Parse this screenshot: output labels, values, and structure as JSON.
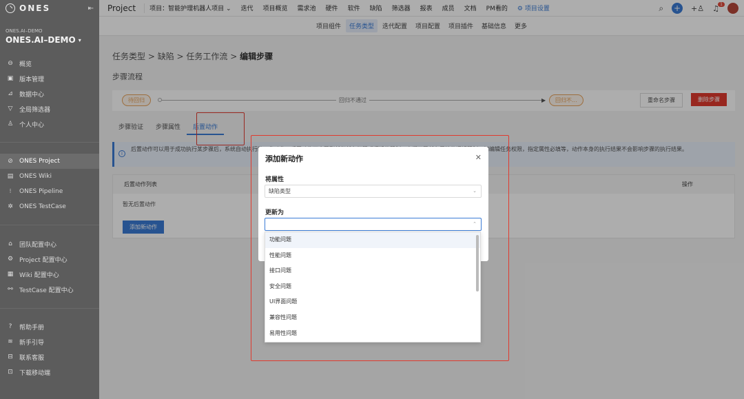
{
  "sidebar": {
    "logo": "ONES",
    "org_small": "ONES.AI–DEMO",
    "org_name": "ONES.AI–DEMO",
    "group1": [
      {
        "label": "概览",
        "icon": "overview-icon"
      },
      {
        "label": "版本管理",
        "icon": "version-icon"
      },
      {
        "label": "数据中心",
        "icon": "chart-icon"
      },
      {
        "label": "全局筛选器",
        "icon": "filter-icon"
      },
      {
        "label": "个人中心",
        "icon": "user-icon"
      }
    ],
    "group2": [
      {
        "label": "ONES Project",
        "icon": "project-icon",
        "active": true
      },
      {
        "label": "ONES Wiki",
        "icon": "wiki-icon"
      },
      {
        "label": "ONES Pipeline",
        "icon": "pipeline-icon"
      },
      {
        "label": "ONES TestCase",
        "icon": "testcase-icon"
      }
    ],
    "group3": [
      {
        "label": "团队配置中心",
        "icon": "team-config-icon"
      },
      {
        "label": "Project 配置中心",
        "icon": "gear-icon"
      },
      {
        "label": "Wiki 配置中心",
        "icon": "wiki-config-icon"
      },
      {
        "label": "TestCase 配置中心",
        "icon": "testcase-config-icon"
      }
    ],
    "group4": [
      {
        "label": "帮助手册",
        "icon": "help-icon"
      },
      {
        "label": "新手引导",
        "icon": "guide-icon"
      },
      {
        "label": "联系客服",
        "icon": "support-icon"
      },
      {
        "label": "下载移动端",
        "icon": "download-icon"
      }
    ]
  },
  "topbar": {
    "product": "Project",
    "project_select": "项目：智能护理机器人项目",
    "items": [
      "迭代",
      "项目概览",
      "需求池",
      "硬件",
      "软件",
      "缺陷",
      "筛选器",
      "报表",
      "成员",
      "文档",
      "PM看的"
    ],
    "settings": "项目设置",
    "badge": "1"
  },
  "subtabs": [
    {
      "label": "项目组件"
    },
    {
      "label": "任务类型",
      "active": true
    },
    {
      "label": "迭代配置"
    },
    {
      "label": "项目配置"
    },
    {
      "label": "项目插件"
    },
    {
      "label": "基础信息"
    },
    {
      "label": "更多"
    }
  ],
  "breadcrumb": {
    "p1": "任务类型",
    "p2": "缺陷",
    "p3": "任务工作流",
    "p4": "编辑步骤"
  },
  "section_title": "步骤流程",
  "flow": {
    "from": "待回归",
    "label": "回归不通过",
    "to": "回归不...",
    "rename": "重命名步骤",
    "delete": "删除步骤"
  },
  "tabs": [
    {
      "label": "步骤验证"
    },
    {
      "label": "步骤属性"
    },
    {
      "label": "后置动作",
      "active": true
    }
  ],
  "info_text": "后置动作可以用于成功执行某步骤后，系统自动执行的一些动作。后置动作不会受到任何任务权限或逻辑的限制，它们不受任务属性的逻辑限制，如编辑任务权限，指定属性必填等，动作本身的执行结果不会影响步骤的执行结果。",
  "table": {
    "col1": "后置动作列表",
    "col2": "操作",
    "empty": "暂无后置动作",
    "add": "添加新动作"
  },
  "modal": {
    "title": "添加新动作",
    "field1_label": "将属性",
    "field1_value": "缺陷类型",
    "field2_label": "更新为",
    "field2_value": "",
    "options": [
      "功能问题",
      "性能问题",
      "接口问题",
      "安全问题",
      "UI界面问题",
      "兼容性问题",
      "易用性问题"
    ]
  }
}
